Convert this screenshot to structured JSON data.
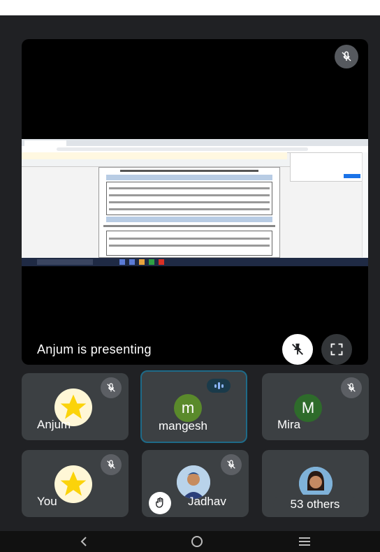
{
  "presenter": {
    "banner": "Anjum is presenting"
  },
  "participants": [
    {
      "name": "Anjum",
      "avatar_type": "star",
      "avatar_color": "#fbd30a",
      "muted": true
    },
    {
      "name": "mangesh",
      "avatar_initial": "m",
      "avatar_color": "#5a8a2b",
      "speaking": true
    },
    {
      "name": "Mira",
      "avatar_initial": "M",
      "avatar_color": "#2e6b2b",
      "muted": true
    },
    {
      "name": "You",
      "avatar_type": "star",
      "avatar_color": "#fbd30a",
      "muted": true
    },
    {
      "name": "Jadhav",
      "avatar_type": "photo",
      "muted": true,
      "hand_raised": true
    },
    {
      "name": "53 others",
      "avatar_type": "photo"
    }
  ],
  "icons": {
    "mic_off": "mic-off-icon",
    "pin_off": "pin-off-icon",
    "fullscreen": "fullscreen-icon",
    "hand": "raised-hand-icon",
    "speaking": "audio-level-icon"
  },
  "colors": {
    "background": "#202124",
    "tile": "#3c4043",
    "active_border": "#1e6a88"
  }
}
